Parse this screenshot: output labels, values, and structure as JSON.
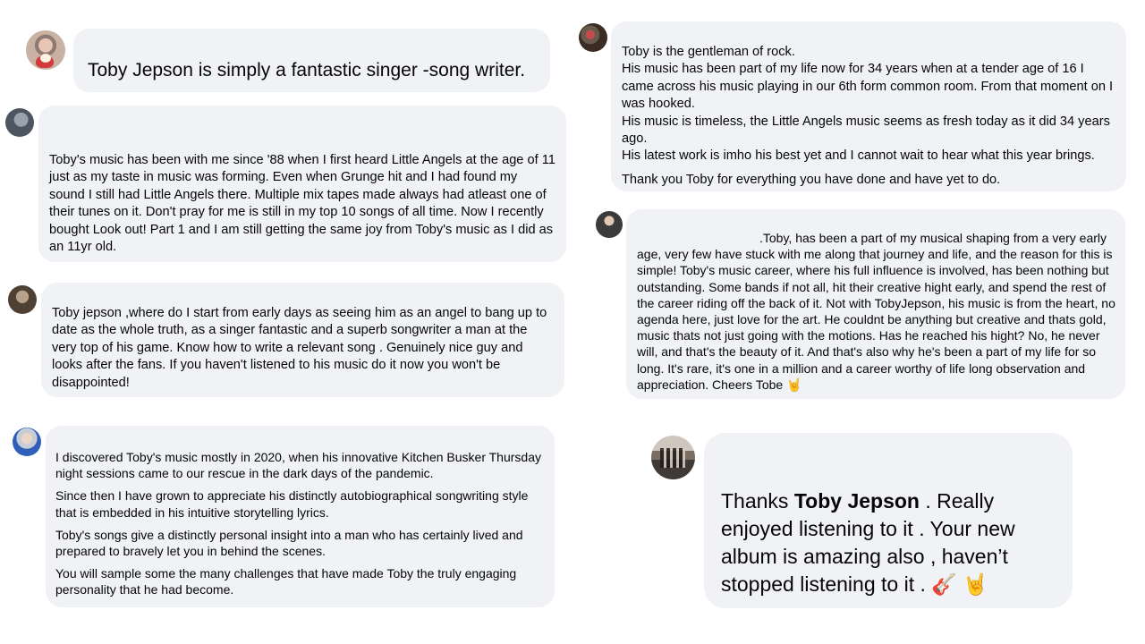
{
  "comments": [
    {
      "avatar": "avatar-person-with-dog",
      "paragraphs": [
        "Toby Jepson is simply a fantastic singer -song writer."
      ]
    },
    {
      "avatar": "avatar-person",
      "paragraphs": [
        "Toby's music has been with me since '88 when I first heard Little Angels at the age of 11 just as my taste in music was forming. Even when Grunge hit and I had found my sound I still had Little Angels there. Multiple mix tapes made always had atleast one of their tunes on it. Don't pray for me is still in my top 10 songs of all time. Now I recently bought Look out! Part 1 and I am still getting the same joy from Toby's music as I did as an 11yr old."
      ]
    },
    {
      "avatar": "avatar-person",
      "paragraphs": [
        "Toby jepson ,where do I start from early days as seeing him as an angel to bang up to date as the whole truth, as a singer fantastic and a superb songwriter a man at the very top of his game. Know how to write a relevant song . Genuinely nice guy and looks after the fans. If you haven't listened to his music do it now you won't be disappointed!"
      ]
    },
    {
      "avatar": "avatar-person",
      "paragraphs": [
        "I discovered Toby's music mostly in 2020, when his innovative Kitchen Busker Thursday night sessions came to our rescue in the dark days of the pandemic.",
        "Since then I have grown to appreciate his distinctly autobiographical songwriting style that is embedded in his intuitive storytelling lyrics.",
        "Toby's songs give a distinctly personal insight into a man who has certainly lived and prepared to bravely let you in behind the scenes.",
        "You will sample some the many challenges that have made Toby the truly engaging personality that he had become."
      ]
    },
    {
      "avatar": "avatar-person",
      "paragraphs": [
        "Toby is the gentleman of rock.\nHis music has been part of my life now for 34 years when at a tender age of 16 I came across his music playing in our 6th form common room. From that moment on I was hooked.\nHis music is timeless, the Little Angels music seems as fresh today as it did 34 years ago.\nHis latest work is imho his best yet and I cannot wait to hear what this year brings.",
        "Thank you Toby for everything you have done and have yet to do."
      ]
    },
    {
      "avatar": "avatar-person",
      "paragraphs": [
        ".Toby, has been a part of my musical shaping from a very early age, very few have stuck with me along that journey and life, and the reason for this is simple! Toby's music career, where his full influence is involved, has been nothing but outstanding. Some bands if not all, hit their creative hight early, and spend the rest of the career riding off the back of it. Not with TobyJepson, his music is from the heart, no agenda here, just love for the art. He couldnt be anything but creative and thats gold, music thats not just going with the motions. Has he reached his hight? No, he never will, and that's the beauty of it. And that's also why he's been a part of my life for so long. It's rare, it's one in a million and a career worthy of life long observation and appreciation. Cheers Tobe 🤘"
      ]
    },
    {
      "avatar": "avatar-group-photo",
      "prefix": "Thanks ",
      "mention": "Toby Jepson",
      "suffix": " . Really enjoyed listening to it . Your new album is amazing also , haven’t stopped listening to it . 🎸 🤘"
    }
  ]
}
